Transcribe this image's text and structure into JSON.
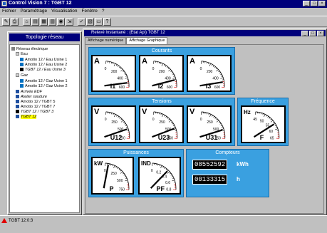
{
  "window": {
    "title": "Control Vision 7 : TGBT 12"
  },
  "menu": [
    "Fichier",
    "Paramétrage",
    "Visualisation",
    "Fenêtre",
    "?"
  ],
  "left_panel": {
    "title": "Topologie réseau",
    "tree": [
      {
        "label": "Réseau électrique",
        "level": 0,
        "highlight": false
      },
      {
        "label": "Eau",
        "level": 1,
        "highlight": false
      },
      {
        "label": "Amotio 12 / Eau Usine 1",
        "level": 2,
        "highlight": false
      },
      {
        "label": "Amotio 12 / Eau Usine 2",
        "level": 2,
        "highlight": false
      },
      {
        "label": "TGBT 12 / Eau Usine 3",
        "level": 2,
        "highlight": false
      },
      {
        "label": "Gaz",
        "level": 1,
        "highlight": false
      },
      {
        "label": "Amotio 12 / Gaz Usine 1",
        "level": 2,
        "highlight": false
      },
      {
        "label": "Amotio 12 / Gaz Usine 2",
        "level": 2,
        "highlight": false
      },
      {
        "label": "Arrivée EDF",
        "level": 1,
        "highlight": false
      },
      {
        "label": "Atelier soudure",
        "level": 1,
        "highlight": false
      },
      {
        "label": "Amotio 12 / TGBT 5",
        "level": 1,
        "highlight": false
      },
      {
        "label": "Amotio 12 / TGBT 7",
        "level": 1,
        "highlight": false
      },
      {
        "label": "TGBT 12 / TGBT 3",
        "level": 1,
        "highlight": false
      },
      {
        "label": "TGBT 12",
        "level": 1,
        "highlight": true
      }
    ]
  },
  "right_panel": {
    "title": "Relevé Instantané : (Etat Api) TGBT 12",
    "tabs": [
      {
        "label": "Affichage numérique",
        "active": false
      },
      {
        "label": "Affichage Graphique",
        "active": true
      }
    ],
    "groups": {
      "courants": "Courants",
      "tensions": "Tensions",
      "frequence": "Fréquence",
      "puissances": "Puissances",
      "compteurs": "Compteurs"
    },
    "gauges": [
      {
        "id": "i1",
        "letter": "A",
        "unit": "I1",
        "ticks": [
          "0",
          "200",
          "400",
          "600"
        ],
        "value_fraction": 0.88
      },
      {
        "id": "i2",
        "letter": "A",
        "unit": "I2",
        "ticks": [
          "0",
          "200",
          "400",
          "600"
        ],
        "value_fraction": 0.8
      },
      {
        "id": "i3",
        "letter": "A",
        "unit": "I3",
        "ticks": [
          "0",
          "200",
          "400",
          "600"
        ],
        "value_fraction": 0.86
      },
      {
        "id": "u12",
        "letter": "V",
        "unit": "U12",
        "ticks": [
          "0",
          "250",
          "500",
          "750"
        ],
        "value_fraction": 0.75
      },
      {
        "id": "u23",
        "letter": "V",
        "unit": "U23",
        "ticks": [
          "0",
          "250",
          "500",
          "750"
        ],
        "value_fraction": 0.73
      },
      {
        "id": "u31",
        "letter": "V",
        "unit": "U31",
        "ticks": [
          "0",
          "250",
          "500",
          "750"
        ],
        "value_fraction": 0.77
      },
      {
        "id": "f",
        "letter": "Hz",
        "unit": "F",
        "ticks": [
          "45",
          "50",
          "55",
          "60",
          "65"
        ],
        "value_fraction": 0.6
      },
      {
        "id": "p",
        "letter": "kW",
        "unit": "P",
        "ticks": [
          "0",
          "250",
          "500",
          "750"
        ],
        "value_fraction": 0.08
      },
      {
        "id": "pf",
        "letter": "IND",
        "unit": "PF",
        "ticks": [
          "0",
          "0.2",
          "0.4",
          "0.6",
          "0.8"
        ],
        "value_fraction": 0.45
      }
    ],
    "counters": [
      {
        "digits": "08552592",
        "unit": "kWh"
      },
      {
        "digits": "00133315",
        "unit": "h"
      }
    ]
  },
  "status_bar": {
    "message": "TGBT 12:0:3"
  },
  "colors": {
    "title_blue": "#00007b",
    "group_blue": "#3aa0e0",
    "highlight": "#ffff00",
    "alarm_red": "#e00000"
  }
}
